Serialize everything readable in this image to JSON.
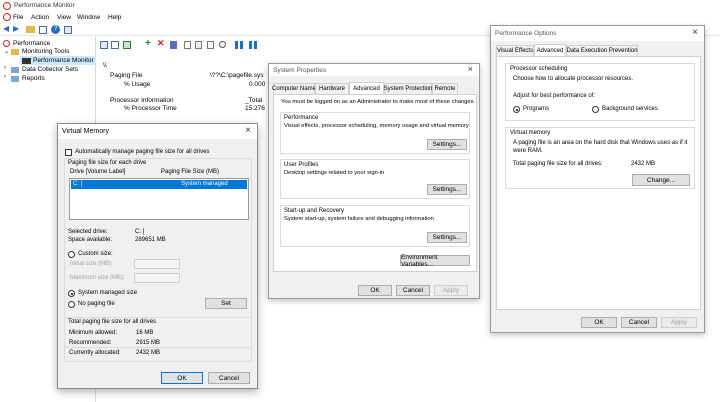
{
  "app": {
    "title": "Performance Monitor",
    "menu": [
      "File",
      "Action",
      "View",
      "Window",
      "Help"
    ]
  },
  "tree": {
    "root": "Performance",
    "monitoring_tools": "Monitoring Tools",
    "performance_monitor": "Performance Monitor",
    "data_collector_sets": "Data Collector Sets",
    "reports": "Reports"
  },
  "counters": {
    "machine": "\\\\",
    "paging_file": "Paging File",
    "paging_instance": "\\??\\C:\\pagefile.sys",
    "usage_label": "% Usage",
    "usage_value": "0.000",
    "processor_info": "Processor Information",
    "processor_instance": "_Total",
    "processor_time_label": "% Processor Time",
    "processor_time_value": "15.276"
  },
  "system_properties": {
    "title": "System Properties",
    "tabs": [
      "Computer Name",
      "Hardware",
      "Advanced",
      "System Protection",
      "Remote"
    ],
    "admin_note": "You must be logged on as an Administrator to make most of these changes.",
    "performance_title": "Performance",
    "performance_desc": "Visual effects, processor scheduling, memory usage and virtual memory",
    "user_profiles_title": "User Profiles",
    "user_profiles_desc": "Desktop settings related to your sign-in",
    "startup_title": "Start-up and Recovery",
    "startup_desc": "System start-up, system failure and debugging information",
    "settings_label": "Settings...",
    "env_vars_label": "Environment Variables...",
    "ok": "OK",
    "cancel": "Cancel",
    "apply": "Apply"
  },
  "performance_options": {
    "title": "Performance Options",
    "tabs": [
      "Visual Effects",
      "Advanced",
      "Data Execution Prevention"
    ],
    "sched_title": "Processor scheduling",
    "sched_desc": "Choose how to allocate processor resources.",
    "adjust_label": "Adjust for best performance of:",
    "programs": "Programs",
    "background": "Background services",
    "vm_title": "Virtual memory",
    "vm_desc": "A paging file is an area on the hard disk that Windows uses as if it were RAM.",
    "total_label": "Total paging file size for all drives:",
    "total_value": "2432 MB",
    "change_label": "Change...",
    "ok": "OK",
    "cancel": "Cancel",
    "apply": "Apply"
  },
  "virtual_memory": {
    "title": "Virtual Memory",
    "auto_manage": "Automatically manage paging file size for all drives",
    "paging_size_each": "Paging file size for each drive",
    "col_drive": "Drive  [Volume Label]",
    "col_size": "Paging File Size (MB)",
    "row_drive": "C:      [",
    "row_size": "System managed",
    "selected_drive_label": "Selected drive:",
    "selected_drive_value": "C:  [",
    "space_label": "Space available:",
    "space_value": "289651 MB",
    "custom_size": "Custom size:",
    "initial_size": "Initial size (MB):",
    "maximum_size": "Maximum size (MB):",
    "system_managed": "System managed size",
    "no_paging": "No paging file",
    "set_label": "Set",
    "total_title": "Total paging file size for all drives",
    "min_label": "Minimum allowed:",
    "min_value": "16 MB",
    "rec_label": "Recommended:",
    "rec_value": "2915 MB",
    "cur_label": "Currently allocated:",
    "cur_value": "2432 MB",
    "ok": "OK",
    "cancel": "Cancel"
  }
}
